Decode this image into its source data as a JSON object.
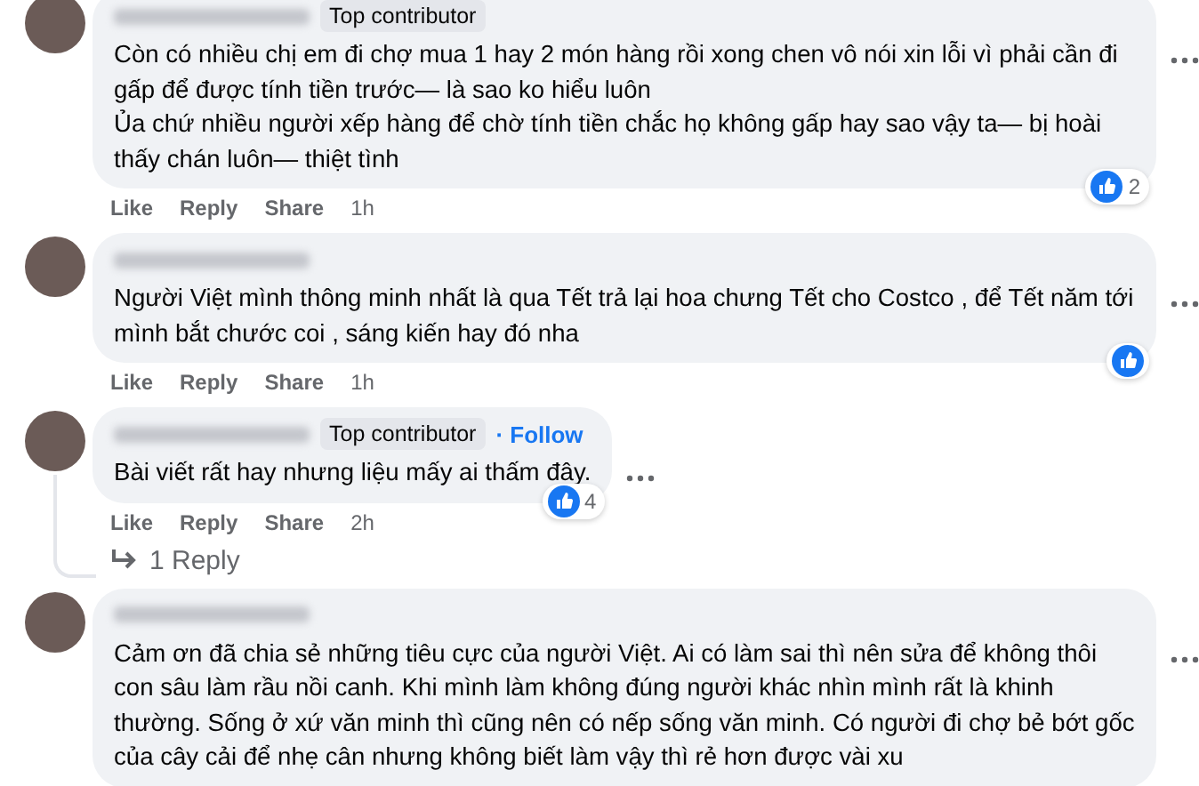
{
  "comments": [
    {
      "badge": "Top contributor",
      "paragraphs": [
        "Còn có nhiều chị em đi chợ mua 1 hay 2 món hàng rồi xong chen vô nói xin lỗi vì phải cần đi gấp để được tính tiền trước— là sao ko hiểu luôn",
        "Ủa chứ nhiều người xếp hàng để chờ tính tiền chắc họ không gấp hay sao vậy ta— bị hoài thấy chán luôn— thiệt tình"
      ],
      "actions": [
        "Like",
        "Reply",
        "Share"
      ],
      "time": "1h",
      "reacted": true,
      "reaction_count": "2"
    },
    {
      "paragraphs": [
        "Người Việt mình thông minh nhất là qua Tết trả lại hoa chưng Tết cho Costco , để Tết năm tới mình bắt chước coi , sáng kiến hay đó nha"
      ],
      "actions": [
        "Like",
        "Reply",
        "Share"
      ],
      "time": "1h",
      "reacted": true
    },
    {
      "badge": "Top contributor",
      "follow": "· Follow",
      "paragraphs": [
        "Bài viết rất hay nhưng liệu mấy ai thấm đây."
      ],
      "actions": [
        "Like",
        "Reply",
        "Share"
      ],
      "time": "2h",
      "reacted": true,
      "reaction_count": "4",
      "replies": "1 Reply"
    },
    {
      "paragraphs": [
        "Cảm ơn đã chia sẻ những tiêu cực của người Việt. Ai có làm sai thì nên sửa để không thôi con sâu làm rầu nồi canh. Khi mình làm không đúng người khác nhìn mình rất là khinh thường. Sống ở xứ văn minh thì cũng nên có nếp sống văn minh. Có người đi chợ bẻ bớt gốc của cây cải để nhẹ cân nhưng không biết làm vậy thì rẻ hơn được vài xu"
      ],
      "reacted": false
    }
  ]
}
